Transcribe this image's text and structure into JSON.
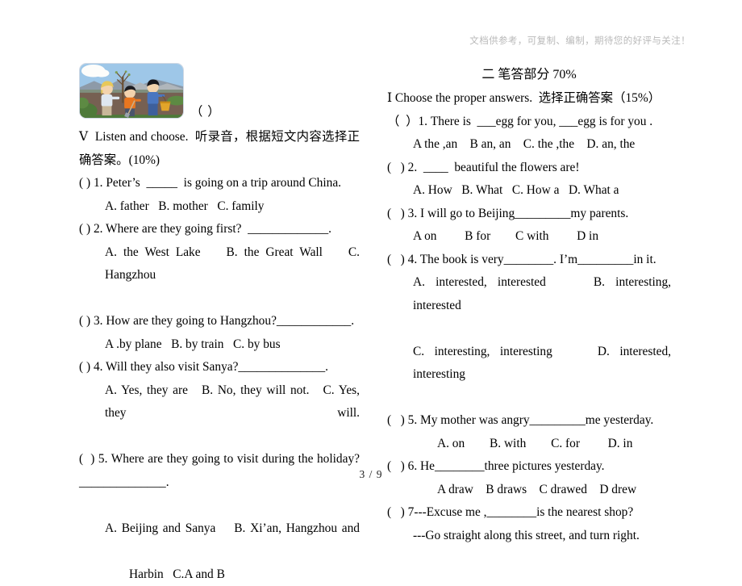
{
  "watermark": "文档供参考，可复制、编制，期待您的好评与关注！",
  "figure": {
    "alt_name": "children-planting-tree-illustration",
    "blank_marker": "（  ）"
  },
  "left_column": {
    "section_heading": "Ⅴ  Listen and choose.  听录音，根据短文内容选择正确答案。(10%)",
    "items": [
      {
        "stem": "( ) 1. Peter’s  _____  is going on a trip around China.",
        "options": "A. father   B. mother   C. family"
      },
      {
        "stem": "( ) 2. Where are they going first?  _____________.",
        "options": "A. the West Lake    B. the Great Wall    C. Hangzhou"
      },
      {
        "stem": "( ) 3. How are they going to Hangzhou?____________.",
        "options": "A .by plane   B. by train   C. by bus"
      },
      {
        "stem": "( ) 4. Will they also visit Sanya?______________.",
        "options": "A. Yes, they are   B. No, they will not.   C. Yes, they will."
      },
      {
        "stem": "(  ) 5. Where are they going to visit during the holiday?______________.",
        "options_line1": "A. Beijing and Sanya    B. Xi’an, Hangzhou and",
        "options_line2": "Harbin   C.A and B"
      }
    ]
  },
  "right_column": {
    "part_heading": "二  笔答部分 70%",
    "section_heading": "Ⅰ Choose the proper answers.  选择正确答案（15%）",
    "items": [
      {
        "stem": "（  ）1. There is  ___egg for you, ___egg is for you .",
        "options": "A the ,an    B an, an    C. the ,the    D. an, the"
      },
      {
        "stem": "(   ) 2.  ____  beautiful the flowers are!",
        "options": "A. How   B. What   C. How a   D. What a"
      },
      {
        "stem": "(   ) 3. I will go to Beijing_________my parents.",
        "options": "A on         B for        C with         D in"
      },
      {
        "stem": "(   ) 4. The book is very________. I’m_________in it.",
        "options_line1": "A.  interested,  interested         B.  interesting, interested",
        "options_line2": "C.  interesting,  interesting         D.  interested, interesting"
      },
      {
        "stem": "(   ) 5. My mother was angry_________me yesterday.",
        "options": "A. on        B. with        C. for         D. in"
      },
      {
        "stem": "(   ) 6. He________three pictures yesterday.",
        "options": "A draw    B draws    C drawed    D drew"
      },
      {
        "stem": "(   ) 7---Excuse me ,________is the nearest shop?",
        "options": "---Go straight along this street, and turn right."
      }
    ]
  },
  "footer": {
    "page_label": "3  / 9"
  }
}
